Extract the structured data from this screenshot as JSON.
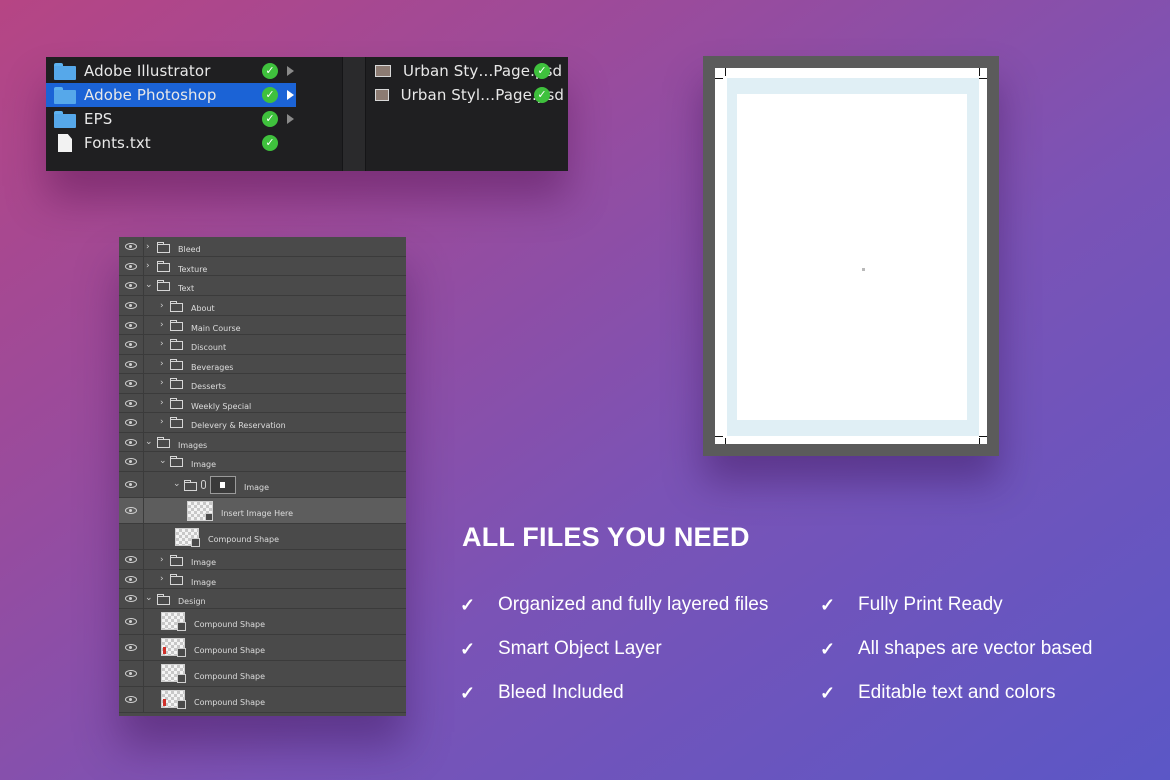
{
  "finder": {
    "column1": [
      {
        "name": "Adobe Illustrator",
        "type": "folder",
        "selected": false,
        "has_children": true
      },
      {
        "name": "Adobe Photoshop",
        "type": "folder",
        "selected": true,
        "has_children": true
      },
      {
        "name": "EPS",
        "type": "folder",
        "selected": false,
        "has_children": true
      },
      {
        "name": "Fonts.txt",
        "type": "document",
        "selected": false,
        "has_children": false
      }
    ],
    "column2": [
      {
        "name": "Urban Sty…Page.psd",
        "type": "psd"
      },
      {
        "name": "Urban Styl…Page.psd",
        "type": "psd"
      }
    ],
    "status_icon": "green-check-icon",
    "selection_color": "#1b63d6"
  },
  "layers": [
    {
      "name": "Bleed",
      "kind": "group",
      "expanded": false
    },
    {
      "name": "Texture",
      "kind": "group",
      "expanded": false
    },
    {
      "name": "Text",
      "kind": "group",
      "expanded": true
    },
    {
      "name": "About",
      "kind": "group",
      "expanded": false
    },
    {
      "name": "Main Course",
      "kind": "group",
      "expanded": false
    },
    {
      "name": "Discount",
      "kind": "group",
      "expanded": false
    },
    {
      "name": "Beverages",
      "kind": "group",
      "expanded": false
    },
    {
      "name": "Desserts",
      "kind": "group",
      "expanded": false
    },
    {
      "name": "Weekly Special",
      "kind": "group",
      "expanded": false
    },
    {
      "name": "Delevery & Reservation",
      "kind": "group",
      "expanded": false
    },
    {
      "name": "Images",
      "kind": "group",
      "expanded": true
    },
    {
      "name": "Image",
      "kind": "group",
      "expanded": true
    },
    {
      "name": "Image",
      "kind": "masked-group",
      "expanded": true
    },
    {
      "name": "Insert Image Here",
      "kind": "smart-object",
      "selected": true
    },
    {
      "name": "Compound Shape",
      "kind": "shape"
    },
    {
      "name": "Image",
      "kind": "group",
      "expanded": false
    },
    {
      "name": "Image",
      "kind": "group",
      "expanded": false
    },
    {
      "name": "Design",
      "kind": "group",
      "expanded": true
    },
    {
      "name": "Compound Shape",
      "kind": "shape"
    },
    {
      "name": "Compound Shape",
      "kind": "shape"
    },
    {
      "name": "Compound Shape",
      "kind": "shape"
    },
    {
      "name": "Compound Shape",
      "kind": "shape"
    }
  ],
  "features": {
    "title": "ALL FILES YOU NEED",
    "items": [
      "Organized and fully layered files",
      "Fully Print Ready",
      "Smart Object Layer",
      "All shapes are vector based",
      "Bleed Included",
      "Editable text and colors"
    ],
    "bullet_icon": "checkmark-icon"
  },
  "colors": {
    "background_start": "#b64584",
    "background_end": "#5b57c6",
    "check_green": "#3fc13d",
    "bleed_tint": "#e0eff5"
  }
}
